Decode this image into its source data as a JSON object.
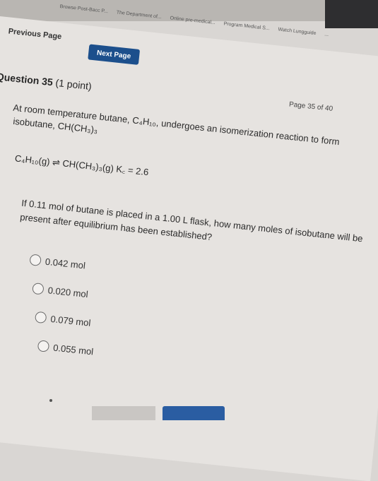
{
  "browser": {
    "bookmarks": [
      "Browse Post-Bacc P...",
      "The Department of...",
      "Online pre-medical...",
      "Program Medical S...",
      "Watch Lungguide",
      "..."
    ]
  },
  "nav": {
    "previous_label": "Previous Page",
    "next_label": "Next Page",
    "next_color": "#1c4f8c"
  },
  "question": {
    "number_label": "Question 35",
    "points": "(1 point)",
    "page_info": "Page 35 of 40",
    "stem_line1": "At room temperature butane, C₄H₁₀, undergoes an isomerization reaction to form",
    "stem_line2": "isobutane, CH(CH₃)₃",
    "reaction": "C₄H₁₀(g) ⇌ CH(CH₃)₃(g)   K꜀ = 2.6",
    "prompt": "If 0.11 mol of butane is placed in a 1.00 L flask, how many moles of isobutane will be present after equilibrium has been established?"
  },
  "options": [
    {
      "label": "0.042 mol"
    },
    {
      "label": "0.020 mol"
    },
    {
      "label": "0.079 mol"
    },
    {
      "label": "0.055 mol"
    }
  ]
}
